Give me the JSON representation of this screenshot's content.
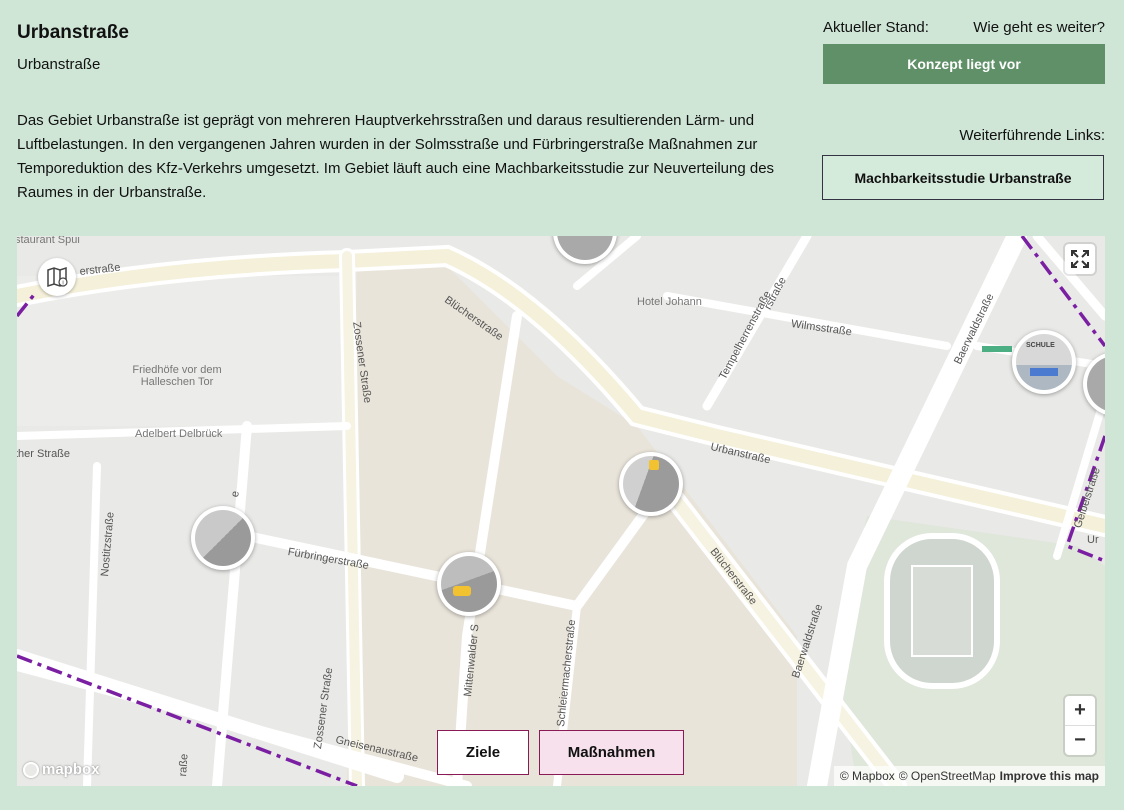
{
  "header": {
    "title": "Urbanstraße",
    "subtitle": "Urbanstraße",
    "description": "Das Gebiet Urbanstraße ist geprägt von mehreren Hauptverkehrsstraßen und daraus resultierenden Lärm- und Luftbelastungen. In den vergangenen Jahren wurden in der Solmsstraße und Fürbringerstraße Maßnahmen zur Temporeduktion des Kfz-Verkehrs umgesetzt. Im Gebiet läuft auch eine Machbarkeitsstudie zur Neuverteilung des Raumes in der Urbanstraße."
  },
  "status": {
    "current_label": "Aktueller Stand:",
    "next_label": "Wie geht es weiter?",
    "value": "Konzept liegt vor",
    "color": "#5f9068"
  },
  "links": {
    "label": "Weiterführende Links:",
    "items": [
      "Machbarkeitsstudie Urbanstraße"
    ]
  },
  "map": {
    "places": {
      "restaurant": "staurant Spui",
      "hotel": "Hotel Johann",
      "cemetery": "Friedhöfe vor dem Halleschen Tor",
      "adelbert": "Adelbert Delbrück"
    },
    "streets": {
      "s1": "erstraße",
      "s2": "Blücherstraße",
      "s3": "Zossener Straße",
      "s4": "Tempelherrenstraße",
      "s5": "Wilmsstraße",
      "s6": "Baerwaldstraße",
      "s7": "Urbanstraße",
      "s8": "ther Straße",
      "s9": "Fürbringerstraße",
      "s10": "Nostitzstraße",
      "s11": "Blücherstraße",
      "s12": "Baerwaldstraße",
      "s13": "Mittenwalder S",
      "s14": "Schleiermacherstraße",
      "s15": "Zossener Straße",
      "s16": "Gneisenaustraße",
      "s17": "Geibelstraße",
      "s18": "Ur",
      "s19": "e",
      "s20": "raße",
      "s21": "rstraße"
    },
    "marker_school_text": "SCHULE",
    "zoom_in": "+",
    "zoom_out": "−",
    "logo": "mapbox",
    "attribution": {
      "mapbox": "© Mapbox",
      "osm": "© OpenStreetMap",
      "improve": "Improve this map"
    },
    "tabs": [
      "Ziele",
      "Maßnahmen"
    ],
    "accent_purple": "#7b1fa2",
    "accent_tab_border": "#8a1a55"
  }
}
